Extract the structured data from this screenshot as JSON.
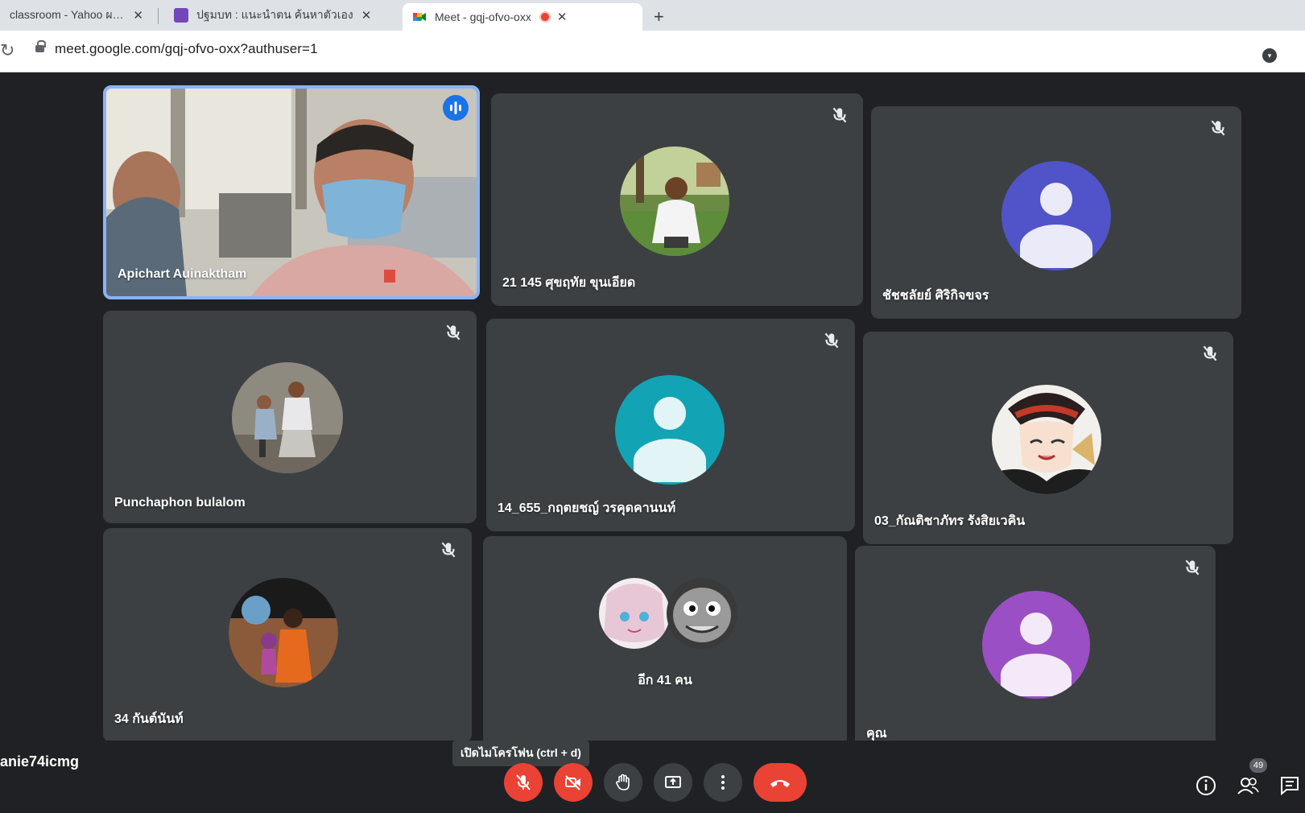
{
  "browser": {
    "tabs": [
      {
        "title": "classroom - Yahoo ผลค้นหา",
        "active": false
      },
      {
        "title": "ปฐมบท : แนะนำตน ค้นหาตัวเอง",
        "active": false
      },
      {
        "title": "Meet - gqj-ofvo-oxx",
        "active": true
      }
    ],
    "close_glyph": "✕",
    "new_tab_glyph": "+",
    "reload_glyph": "↻",
    "url": "meet.google.com/gqj-ofvo-oxx?authuser=1"
  },
  "meeting": {
    "tiles": [
      {
        "name": "Apichart Auinaktham",
        "type": "video",
        "speaking": true
      },
      {
        "name": "21 145 ศุขฤทัย ขุนเอียด",
        "type": "photo",
        "muted": true
      },
      {
        "name": "ชัชชลัยย์ ศิริกิจขจร",
        "type": "initial",
        "avatar_color": "#5054c8",
        "muted": true
      },
      {
        "name": "Punchaphon bulalom",
        "type": "photo",
        "muted": true
      },
      {
        "name": "14_655_กฤตยชญ์ วรคุดคานนท์",
        "type": "initial",
        "avatar_color": "#12a4b4",
        "muted": true
      },
      {
        "name": "03_กัณติชาภัทร รังสิยเวคิน",
        "type": "photo",
        "muted": true
      },
      {
        "name": "34 กันต์นันท์",
        "type": "photo",
        "muted": true
      },
      {
        "name": "อีก 41 คน",
        "type": "group"
      },
      {
        "name": "คุณ",
        "type": "initial",
        "avatar_color": "#9b4fc4",
        "muted": true
      }
    ],
    "meeting_code": "anie74icmg",
    "tooltip": "เปิดไมโครโฟน (ctrl + d)",
    "controls": [
      "mic-off-icon",
      "camera-off-icon",
      "raise-hand-icon",
      "present-icon",
      "more-icon",
      "end-call-icon"
    ],
    "participant_count": "49"
  },
  "colors": {
    "mute_red": "#ea4335",
    "speaking_border": "#8ab4f8",
    "tile_bg": "#3c4043",
    "page_bg": "#202124"
  }
}
